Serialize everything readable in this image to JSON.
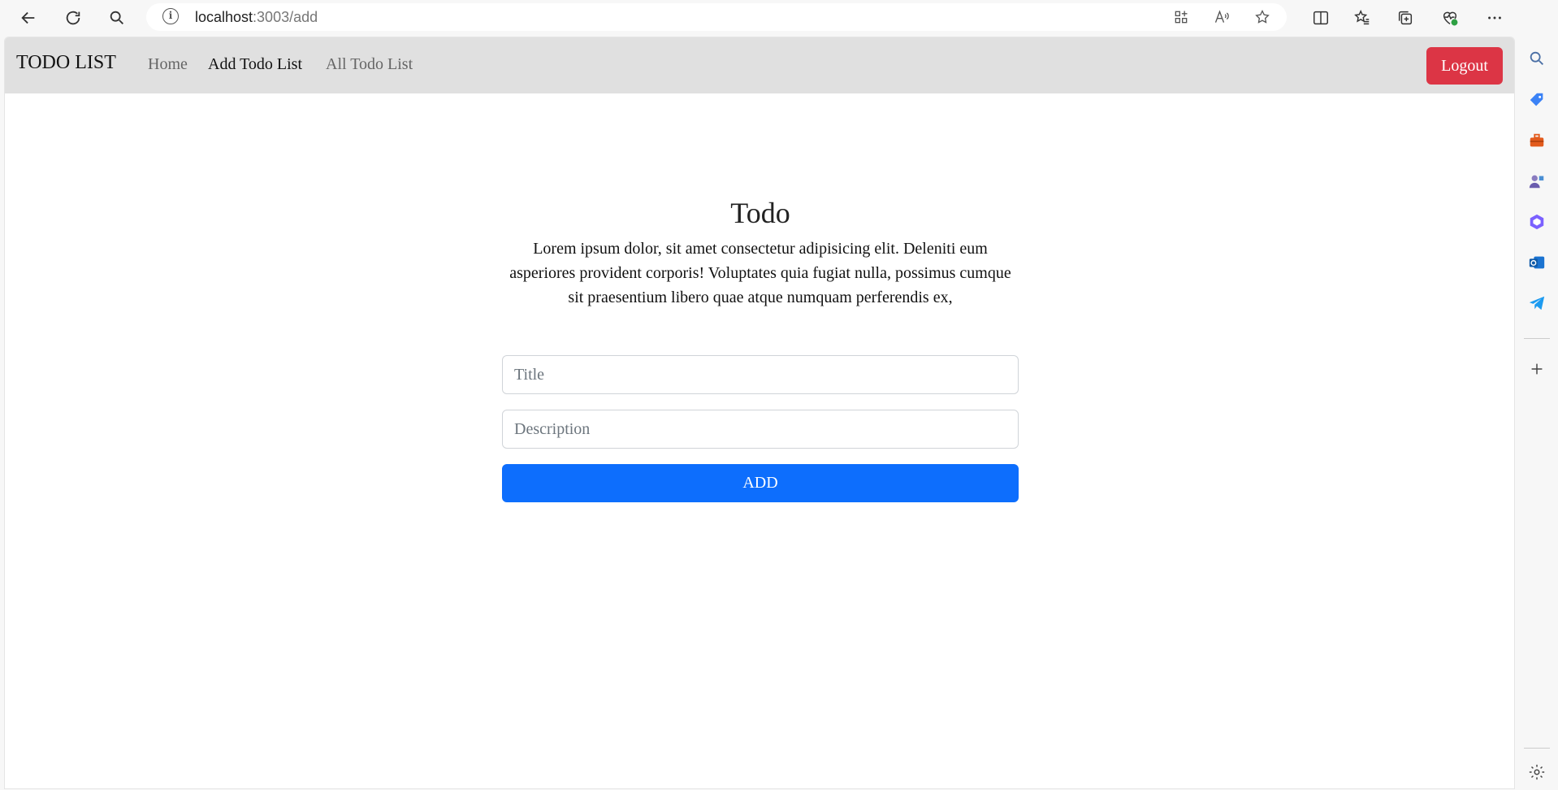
{
  "browser": {
    "url_host": "localhost",
    "url_path": ":3003/add"
  },
  "navbar": {
    "brand": "TODO LIST",
    "links": [
      {
        "label": "Home",
        "active": false
      },
      {
        "label": "Add Todo List",
        "active": true
      },
      {
        "label": "All Todo List",
        "active": false
      }
    ],
    "logout_label": "Logout"
  },
  "main": {
    "title": "Todo",
    "description": "Lorem ipsum dolor, sit amet consectetur adipisicing elit. Deleniti eum asperiores provident corporis! Voluptates quia fugiat nulla, possimus cumque sit praesentium libero quae atque numquam perferendis ex,"
  },
  "form": {
    "title_placeholder": "Title",
    "title_value": "",
    "description_placeholder": "Description",
    "description_value": "",
    "submit_label": "ADD"
  },
  "colors": {
    "navbar_bg": "#e0e0e0",
    "logout_bg": "#dc3545",
    "add_bg": "#0d6efd"
  },
  "icons": {
    "toolbar": [
      "back-icon",
      "refresh-icon",
      "search-icon",
      "info-icon",
      "apps-icon",
      "read-aloud-icon",
      "favorite-star-icon",
      "split-screen-icon",
      "favorites-icon",
      "collections-icon",
      "browser-essentials-icon",
      "more-icon",
      "copilot-icon"
    ],
    "sidebar": [
      "search-icon",
      "shopping-tag-icon",
      "tools-icon",
      "people-icon",
      "office-icon",
      "outlook-icon",
      "telegram-icon",
      "add-icon",
      "settings-icon"
    ]
  }
}
